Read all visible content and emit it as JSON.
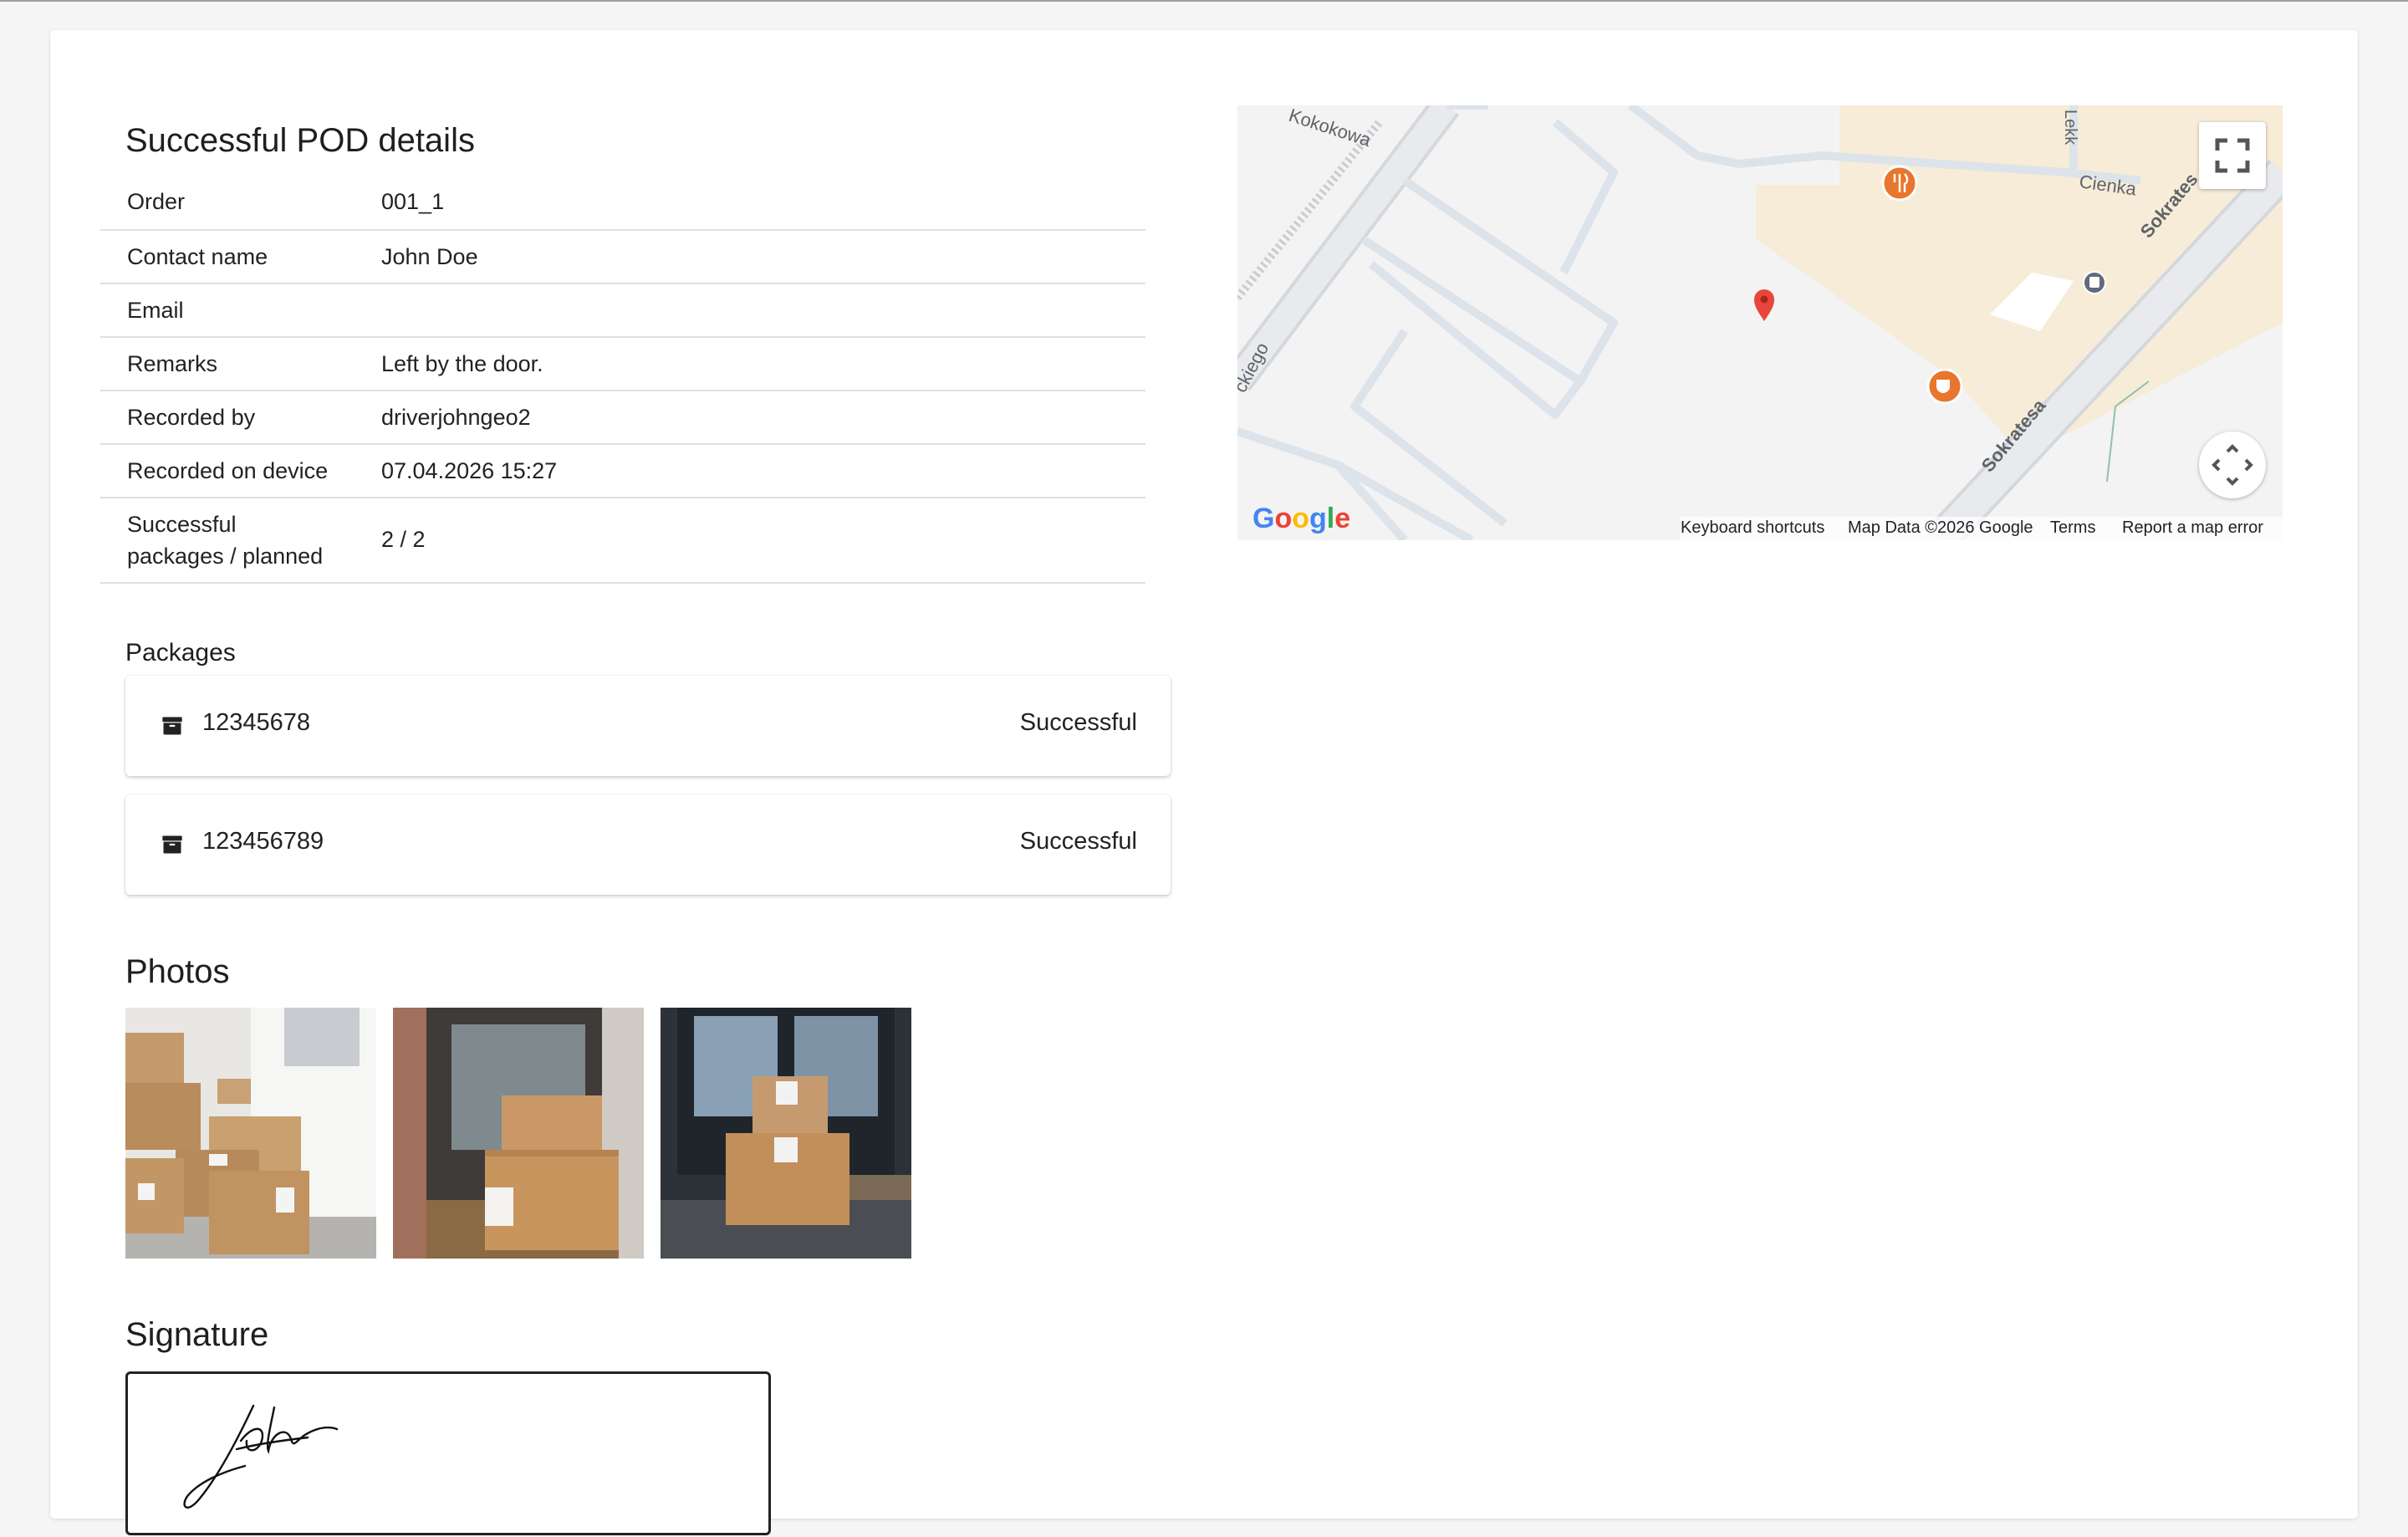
{
  "page": {
    "title": "Successful POD details"
  },
  "details": [
    {
      "label": "Order",
      "value": "001_1"
    },
    {
      "label": "Contact name",
      "value": "John Doe"
    },
    {
      "label": "Email",
      "value": ""
    },
    {
      "label": "Remarks",
      "value": "Left by the door."
    },
    {
      "label": "Recorded by",
      "value": "driverjohngeo2"
    },
    {
      "label": "Recorded on device",
      "value": "07.04.2026 15:27"
    },
    {
      "label_line1": "Successful",
      "label_line2": "packages / planned",
      "value": "2 / 2"
    }
  ],
  "packages": {
    "heading": "Packages",
    "items": [
      {
        "number": "12345678",
        "status": "Successful",
        "icon": "archive-box-icon"
      },
      {
        "number": "123456789",
        "status": "Successful",
        "icon": "archive-box-icon"
      }
    ]
  },
  "photos": {
    "heading": "Photos",
    "count": 3
  },
  "signature": {
    "heading": "Signature"
  },
  "map": {
    "streets": [
      "Kokokowa",
      "ckiego",
      "Lekk",
      "Cienka",
      "Sokratesa",
      "Sokrates"
    ],
    "footer": {
      "keyboard": "Keyboard shortcuts",
      "data": "Map Data ©2026 Google",
      "terms": "Terms",
      "report": "Report a map error"
    },
    "logo": "Google",
    "marker_color": "#e8453c",
    "poi_color": "#e8762d",
    "controls": [
      "fullscreen-icon",
      "pan-control-icon"
    ]
  }
}
